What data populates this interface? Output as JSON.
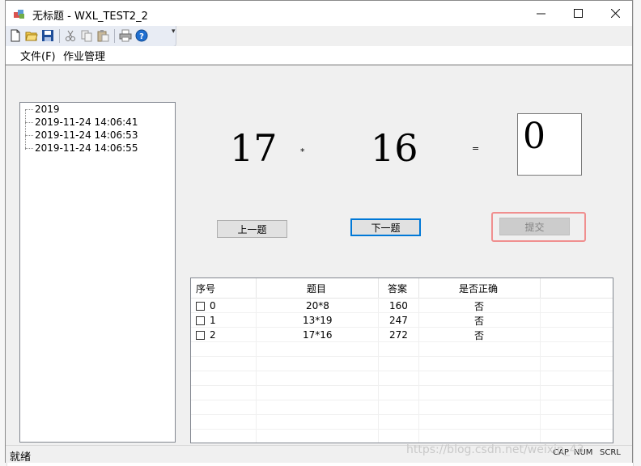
{
  "window": {
    "title": "无标题 - WXL_TEST2_2",
    "minimize": "—",
    "maximize": "☐",
    "close": "✕"
  },
  "toolbar": {
    "icons": [
      "new-file-icon",
      "open-folder-icon",
      "save-icon",
      "cut-icon",
      "copy-icon",
      "paste-icon",
      "print-icon",
      "help-icon"
    ]
  },
  "menu": {
    "file": "文件(F)",
    "homework": "作业管理"
  },
  "tree": {
    "items": [
      "2019",
      "2019-11-24 14:06:41",
      "2019-11-24 14:06:53",
      "2019-11-24 14:06:55"
    ]
  },
  "equation": {
    "left": "17",
    "operator": "*",
    "right": "16",
    "equals": "=",
    "answer": "0"
  },
  "buttons": {
    "prev": "上一题",
    "next": "下一题",
    "submit": "提交"
  },
  "list": {
    "columns": [
      "序号",
      "题目",
      "答案",
      "是否正确"
    ],
    "rows": [
      {
        "index": "0",
        "question": "20*8",
        "answer": "160",
        "correct": "否"
      },
      {
        "index": "1",
        "question": "13*19",
        "answer": "247",
        "correct": "否"
      },
      {
        "index": "2",
        "question": "17*16",
        "answer": "272",
        "correct": "否"
      }
    ]
  },
  "status": {
    "text": "就绪",
    "cap": "CAP",
    "num": "NUM",
    "scrl": "SCRL"
  },
  "watermark": "https://blog.csdn.net/weixin_43"
}
